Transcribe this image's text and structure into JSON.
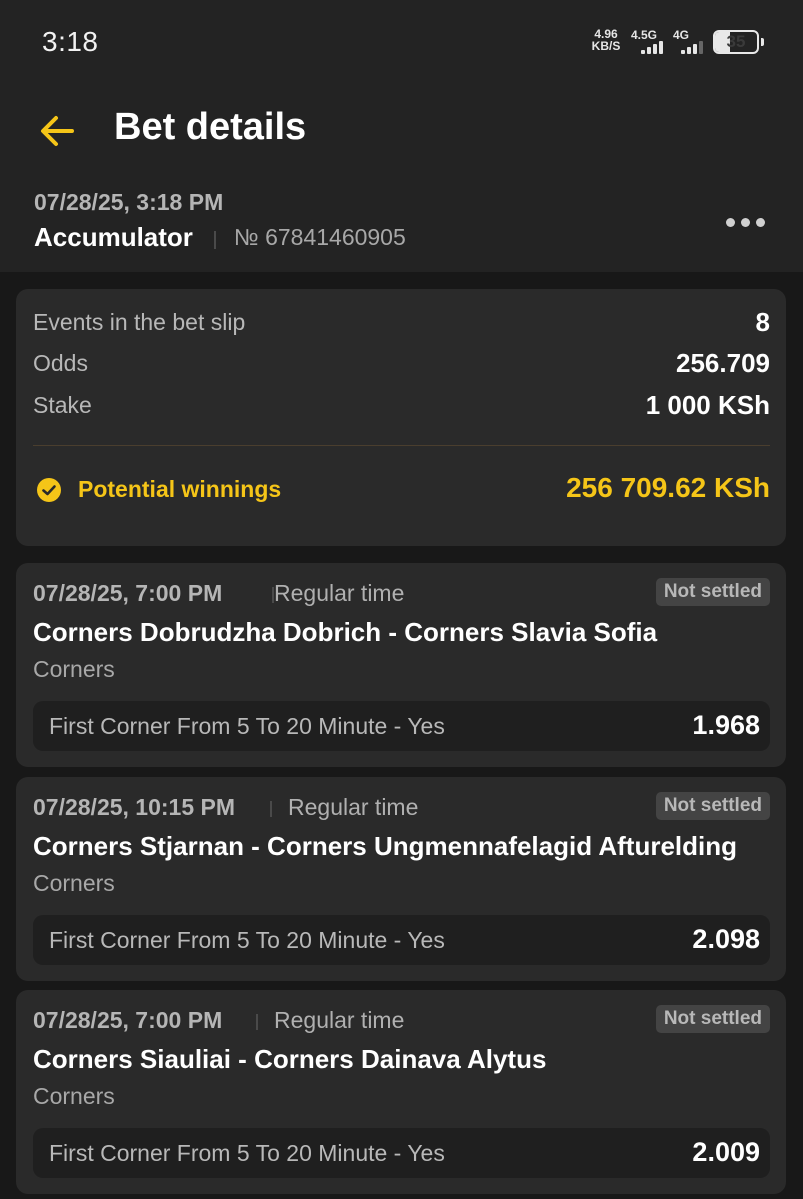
{
  "status_bar": {
    "time": "3:18",
    "net_speed_value": "4.96",
    "net_speed_unit": "KB/S",
    "signal1": "4.5G",
    "signal2": "4G",
    "battery": "35",
    "battery_level": 0.35
  },
  "header": {
    "title": "Bet details",
    "bet_date": "07/28/25, 3:18 PM",
    "bet_type": "Accumulator",
    "bet_number": "№ 67841460905"
  },
  "summary": {
    "rows": [
      {
        "label": "Events in the bet slip",
        "value": "8"
      },
      {
        "label": "Odds",
        "value": "256.709"
      },
      {
        "label": "Stake",
        "value": "1 000 KSh"
      }
    ],
    "potential_label": "Potential winnings",
    "potential_value": "256 709.62 KSh"
  },
  "events": [
    {
      "date": "07/28/25, 7:00 PM",
      "period": "Regular time",
      "status": "Not settled",
      "match": "Corners Dobrudzha Dobrich - Corners Slavia Sofia",
      "market": "Corners",
      "pick": "First Corner From 5 To 20 Minute - Yes",
      "odds": "1.968"
    },
    {
      "date": "07/28/25, 10:15 PM",
      "period": "Regular time",
      "status": "Not settled",
      "match": "Corners Stjarnan - Corners Ungmennafelagid Afturelding",
      "market": "Corners",
      "pick": "First Corner From 5 To 20 Minute - Yes",
      "odds": "2.098"
    },
    {
      "date": "07/28/25, 7:00 PM",
      "period": "Regular time",
      "status": "Not settled",
      "match": "Corners Siauliai - Corners Dainava Alytus",
      "market": "Corners",
      "pick": "First Corner From 5 To 20 Minute - Yes",
      "odds": "2.009"
    }
  ],
  "colors": {
    "accent": "#f5c518",
    "background": "#181818",
    "card": "#2a2a2a"
  }
}
